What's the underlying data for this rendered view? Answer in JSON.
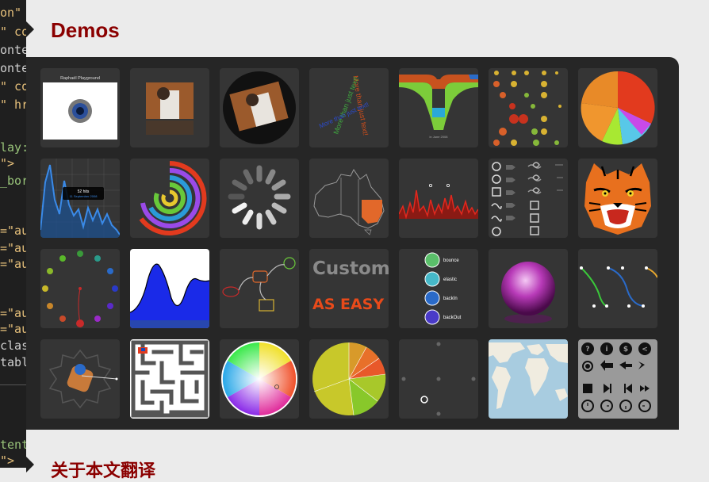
{
  "code_editor": {
    "lines": [
      {
        "text": "on\"",
        "color": "#e6c07b"
      },
      {
        "text": "\" co",
        "color": "#e6c07b"
      },
      {
        "text": "onte",
        "color": "#cfcfcf"
      },
      {
        "text": "onte",
        "color": "#cfcfcf"
      },
      {
        "text": "\" co",
        "color": "#e6c07b"
      },
      {
        "text": "\" hr",
        "color": "#e6c07b"
      },
      {
        "text": "lay:",
        "color": "#98c379"
      },
      {
        "text": "\">",
        "color": "#e6c07b"
      },
      {
        "text": "_bor",
        "color": "#98c379"
      },
      {
        "text": "=\"au",
        "color": "#e6c07b"
      },
      {
        "text": "=\"au",
        "color": "#e6c07b"
      },
      {
        "text": "=\"au",
        "color": "#e6c07b"
      },
      {
        "text": "=\"au",
        "color": "#e6c07b"
      },
      {
        "text": "=\"au",
        "color": "#e6c07b"
      },
      {
        "text": "clas",
        "color": "#cfcfcf"
      },
      {
        "text": "tabl",
        "color": "#cfcfcf"
      },
      {
        "text": "tent",
        "color": "#98c379"
      },
      {
        "text": "\">",
        "color": "#e6c07b"
      }
    ]
  },
  "sections": {
    "demos_title": "Demos",
    "next_title": "关于本文翻译"
  },
  "colors": {
    "heading": "#8b0000",
    "panel": "#262626",
    "tile": "#353535",
    "page_bg": "#ebebeb"
  },
  "tiles": {
    "playground": {
      "title": "Raphaël Playground"
    },
    "text_rotation": {
      "text": "More than just text!"
    },
    "streamgraph": {
      "label": "in June 2008"
    },
    "analytics": {
      "value": "52 hits",
      "date": "11 September 2008"
    },
    "easing": {
      "items": [
        "bounce",
        "elastic",
        "backIn",
        "backOut"
      ]
    },
    "fancy_text": {
      "line1": "Custom",
      "line2": "AS EASY"
    }
  }
}
